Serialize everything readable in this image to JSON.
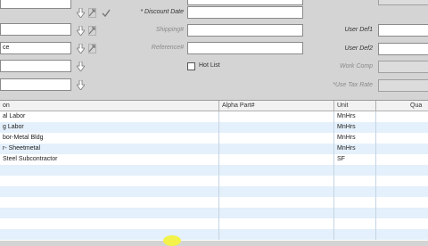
{
  "left_fields": [
    "",
    "",
    "ce",
    "",
    ""
  ],
  "middle": {
    "labels": [
      "* Discount Date",
      "Shipping#",
      "Reference#"
    ],
    "values": [
      "",
      "",
      ""
    ],
    "hot_list_label": "Hot List"
  },
  "right": {
    "labels": [
      "User Def1",
      "User Def2",
      "Work Comp",
      "*Use Tax Rate"
    ],
    "values": [
      "",
      "",
      "",
      ""
    ]
  },
  "grid": {
    "headers": [
      "on",
      "Alpha Part#",
      "Unit",
      "Qua"
    ],
    "rows": [
      {
        "desc": "al Labor",
        "alpha": "",
        "unit": "MnHrs"
      },
      {
        "desc": "g Labor",
        "alpha": "",
        "unit": "MnHrs"
      },
      {
        "desc": "bor-Metal Bldg",
        "alpha": "",
        "unit": "MnHrs"
      },
      {
        "desc": "r- Sheetmetal",
        "alpha": "",
        "unit": "MnHrs"
      },
      {
        "desc": "Steel Subcontractor",
        "alpha": "",
        "unit": "SF"
      },
      {
        "desc": "",
        "alpha": "",
        "unit": ""
      },
      {
        "desc": "",
        "alpha": "",
        "unit": ""
      },
      {
        "desc": "",
        "alpha": "",
        "unit": ""
      },
      {
        "desc": "",
        "alpha": "",
        "unit": ""
      },
      {
        "desc": "",
        "alpha": "",
        "unit": ""
      },
      {
        "desc": "",
        "alpha": "",
        "unit": ""
      },
      {
        "desc": "",
        "alpha": "",
        "unit": ""
      }
    ]
  }
}
